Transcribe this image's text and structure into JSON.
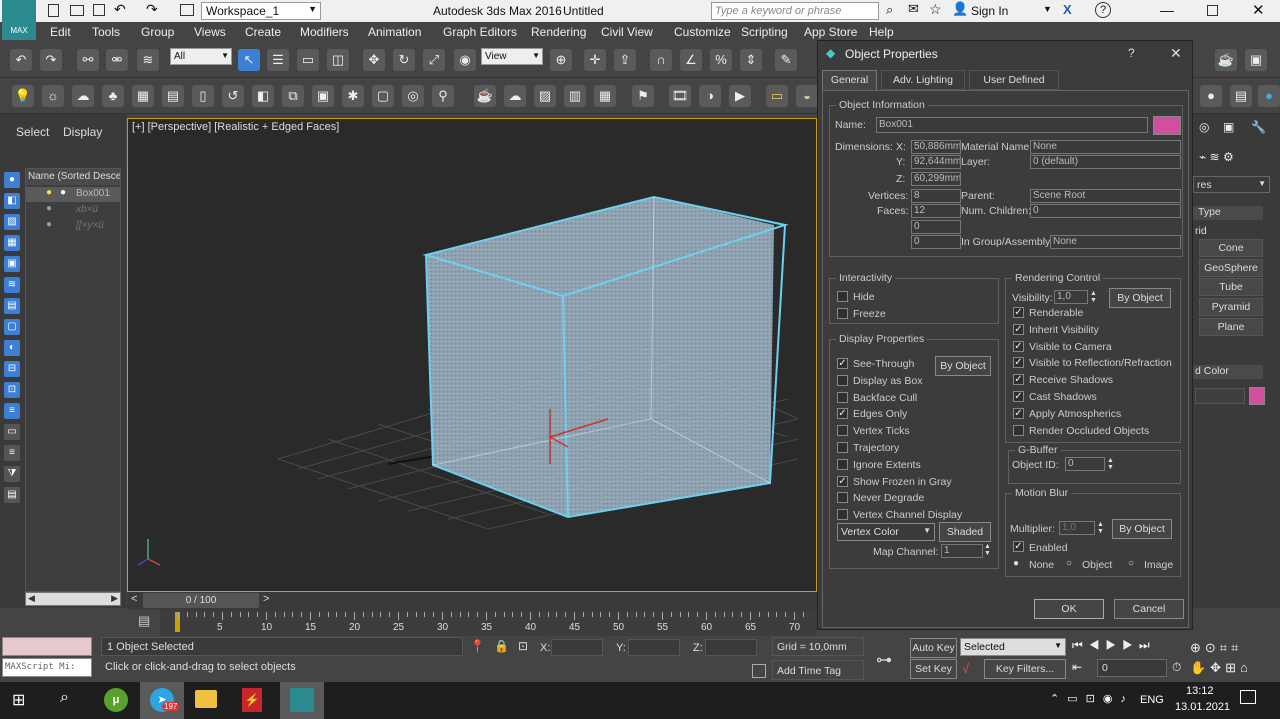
{
  "titlebar": {
    "workspace": "Workspace_1",
    "app_title": "Autodesk 3ds Max 2016",
    "doc_title": "Untitled",
    "search_placeholder": "Type a keyword or phrase",
    "sign_in": "Sign In",
    "logo": "MAX"
  },
  "menu": [
    "Edit",
    "Tools",
    "Group",
    "Views",
    "Create",
    "Modifiers",
    "Animation",
    "Graph Editors",
    "Rendering",
    "Civil View",
    "Customize",
    "Scripting",
    "App Store",
    "Help"
  ],
  "toolbar": {
    "selection_filter": "All",
    "ref_coord": "View"
  },
  "left_panel": {
    "tabs": [
      "Select",
      "Display"
    ],
    "list_header": "Name (Sorted Descer",
    "items": [
      "Box001",
      "xb×ü",
      "[[×y×ü"
    ]
  },
  "viewport": {
    "label": "[+] [Perspective] [Realistic + Edged Faces]"
  },
  "dialog": {
    "title": "Object Properties",
    "help": "?",
    "close": "✕",
    "tabs": [
      "General",
      "Adv. Lighting",
      "User Defined"
    ],
    "object_info": {
      "label": "Object Information",
      "name_label": "Name:",
      "name_value": "Box001",
      "color": "#d050a0",
      "dimensions_label": "Dimensions:",
      "x_label": "X:",
      "x": "50,886mm",
      "y_label": "Y:",
      "y": "92,644mm",
      "z_label": "Z:",
      "z": "60,299mm",
      "vertices_label": "Vertices:",
      "vertices": "8",
      "faces_label": "Faces:",
      "faces": "12",
      "extra1": "0",
      "extra2": "0",
      "material_label": "Material Name:",
      "material": "None",
      "layer_label": "Layer:",
      "layer": "0 (default)",
      "parent_label": "Parent:",
      "parent": "Scene Root",
      "children_label": "Num. Children:",
      "children": "0",
      "group_label": "In Group/Assembly:",
      "group": "None"
    },
    "interactivity": {
      "label": "Interactivity",
      "hide": "Hide",
      "freeze": "Freeze"
    },
    "display_props": {
      "label": "Display Properties",
      "by_object": "By Object",
      "items": [
        {
          "label": "See-Through",
          "checked": true
        },
        {
          "label": "Display as Box",
          "checked": false
        },
        {
          "label": "Backface Cull",
          "checked": false
        },
        {
          "label": "Edges Only",
          "checked": true
        },
        {
          "label": "Vertex Ticks",
          "checked": false
        },
        {
          "label": "Trajectory",
          "checked": false
        },
        {
          "label": "Ignore Extents",
          "checked": false
        },
        {
          "label": "Show Frozen in Gray",
          "checked": true
        },
        {
          "label": "Never Degrade",
          "checked": false
        },
        {
          "label": "Vertex Channel Display",
          "checked": false
        }
      ],
      "vertex_color": "Vertex Color",
      "shaded": "Shaded",
      "map_channel_label": "Map Channel:",
      "map_channel": "1"
    },
    "rendering_control": {
      "label": "Rendering Control",
      "visibility_label": "Visibility:",
      "visibility": "1,0",
      "by_object": "By Object",
      "items": [
        {
          "label": "Renderable",
          "checked": true
        },
        {
          "label": "Inherit Visibility",
          "checked": true
        },
        {
          "label": "Visible to Camera",
          "checked": true
        },
        {
          "label": "Visible to Reflection/Refraction",
          "checked": true
        },
        {
          "label": "Receive Shadows",
          "checked": true
        },
        {
          "label": "Cast Shadows",
          "checked": true
        },
        {
          "label": "Apply Atmospherics",
          "checked": true
        },
        {
          "label": "Render Occluded Objects",
          "checked": false
        }
      ]
    },
    "gbuffer": {
      "label": "G-Buffer",
      "object_id_label": "Object ID:",
      "object_id": "0"
    },
    "motion_blur": {
      "label": "Motion Blur",
      "multiplier_label": "Multiplier:",
      "multiplier": "1,0",
      "by_object": "By Object",
      "enabled": "Enabled",
      "none": "None",
      "object": "Object",
      "image": "Image"
    },
    "ok": "OK",
    "cancel": "Cancel"
  },
  "right_panel": {
    "dropdown": "res",
    "type_label": "Type",
    "rid": "rid",
    "buttons": [
      "Cone",
      "GeoSphere",
      "Tube",
      "Pyramid",
      "Plane"
    ],
    "color_label": "d Color"
  },
  "timeline": {
    "frame": "0 / 100",
    "ticks": [
      "5",
      "10",
      "15",
      "20",
      "25",
      "30",
      "35",
      "40",
      "45",
      "50",
      "55",
      "60",
      "65",
      "70"
    ]
  },
  "status": {
    "maxscript": "MAXScript Mi:",
    "selected": "1 Object Selected",
    "hint": "Click or click-and-drag to select objects",
    "x_label": "X:",
    "y_label": "Y:",
    "z_label": "Z:",
    "grid": "Grid = 10,0mm",
    "add_time_tag": "Add Time Tag",
    "auto_key": "Auto Key",
    "selected_dd": "Selected",
    "set_key": "Set Key",
    "key_filters": "Key Filters...",
    "frame_value": "0"
  },
  "taskbar": {
    "lang": "ENG",
    "time": "13:12",
    "date": "13.01.2021",
    "badge": "197"
  }
}
